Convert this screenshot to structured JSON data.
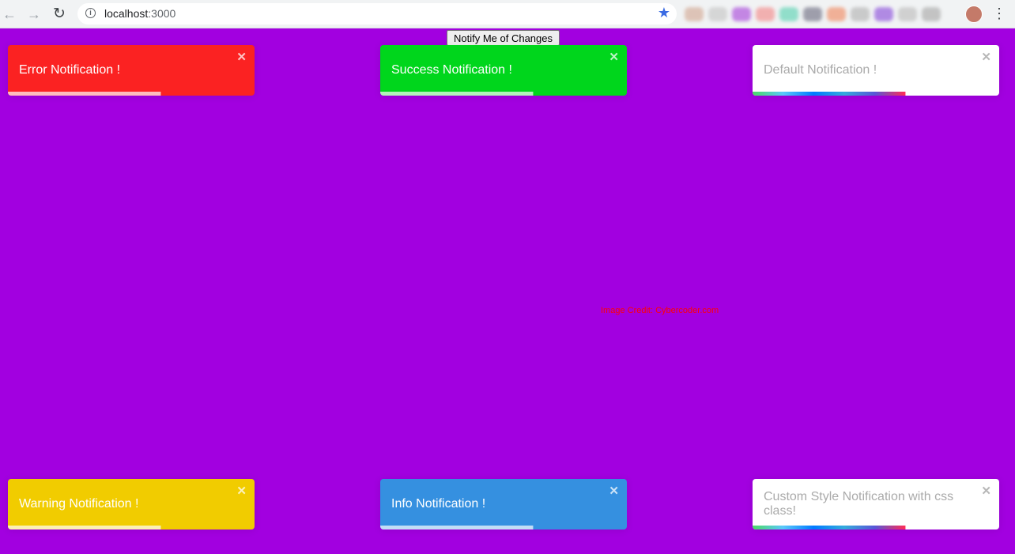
{
  "browser": {
    "url_host": "localhost",
    "url_port": ":3000"
  },
  "page": {
    "notify_button_label": "Notify Me of Changes",
    "credit_text": "Image Credit: Cybercoder.com"
  },
  "toasts": {
    "error": {
      "message": "Error Notification !",
      "close": "✕",
      "progress": 0.62
    },
    "success": {
      "message": "Success Notification !",
      "close": "✕",
      "progress": 0.62
    },
    "default": {
      "message": "Default Notification !",
      "close": "✕",
      "progress": 0.62
    },
    "warning": {
      "message": "Warning Notification !",
      "close": "✕",
      "progress": 0.62
    },
    "info": {
      "message": "Info Notification !",
      "close": "✕",
      "progress": 0.62
    },
    "custom": {
      "message": "Custom Style Notification with css class!",
      "close": "✕",
      "progress": 0.62
    }
  },
  "colors": {
    "page_background": "#a200e0",
    "error": "#fb2222",
    "success": "#00d61c",
    "warning": "#f1cc00",
    "info": "#3590e0",
    "default": "#ffffff"
  }
}
